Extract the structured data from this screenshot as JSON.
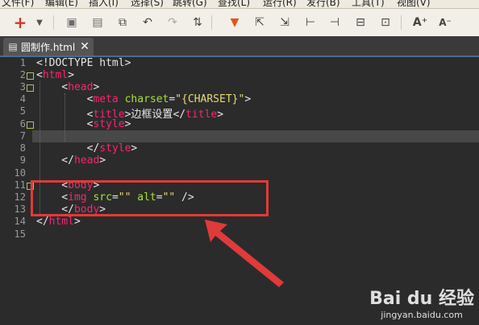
{
  "menu": [
    "文件(F)",
    "编辑(E)",
    "插入(I)",
    "选择(S)",
    "跳转(G)",
    "查找(L)",
    "运行(R)",
    "发行(B)",
    "工具(T)",
    "视图(V)"
  ],
  "toolbar": {
    "icons": [
      "add-icon",
      "dropdown-arrow-icon",
      "save-icon",
      "save-all-icon",
      "copy-icon",
      "undo-icon",
      "redo-icon",
      "format-icon",
      "bookmark-icon",
      "goto-icon",
      "outdent-icon",
      "indent-icon",
      "block-comment-icon",
      "comment-icon",
      "uncomment-icon",
      "font-increase-icon",
      "font-decrease-icon"
    ]
  },
  "tab": {
    "title": "圆制作.html",
    "close": "✕"
  },
  "code": {
    "line_numbers": [
      "1",
      "2",
      "3",
      "4",
      "5",
      "6",
      "7",
      "8",
      "9",
      "10",
      "11",
      "12",
      "13",
      "14",
      "15"
    ],
    "l1": "<!DOCTYPE html>",
    "l2_tag": "html",
    "l3_tag": "head",
    "l4_tag": "meta",
    "l4_attr": "charset",
    "l4_val": "\"{CHARSET}\"",
    "l5_tag": "title",
    "l5_text": "边框设置",
    "l6_tag": "style",
    "l8_tag": "style",
    "l9_tag": "head",
    "l11_tag": "body",
    "l12_tag": "img",
    "l12_attr1": "src",
    "l12_val1": "\"\"",
    "l12_attr2": "alt",
    "l12_val2": "\"\"",
    "l13_tag": "body",
    "l14_tag": "html"
  },
  "watermark": {
    "brand": "Bai du 经验",
    "url": "jingyan.baidu.com"
  }
}
